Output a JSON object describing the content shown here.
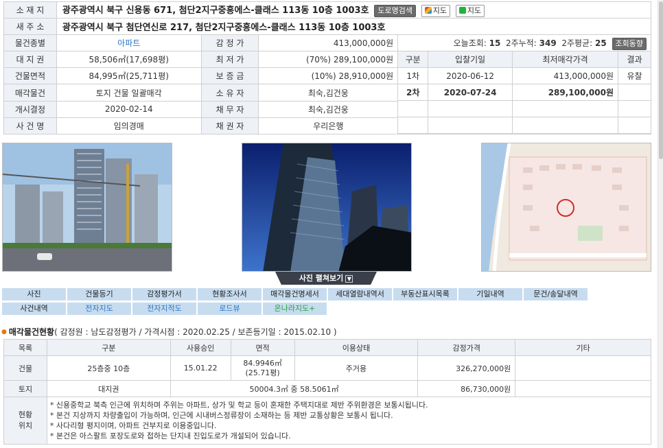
{
  "property": {
    "location_label": "소 재 지",
    "location": "광주광역시 북구 신용동 671, 첨단2지구중흥에스-클래스 113동 10층 1003호",
    "road_search_label": "도로명검색",
    "map_label_1": "지도",
    "map_label_2": "지도",
    "new_address_label": "새 주 소",
    "new_address": "광주광역시 북구 첨단연신로 217, 첨단2지구중흥에스-클래스 113동 10층 1003호",
    "rows": [
      {
        "l1": "물건종별",
        "v1": "아파트",
        "l2": "감 정 가",
        "v2": "413,000,000원"
      },
      {
        "l1": "대 지 권",
        "v1": "58,506㎡(17,698평)",
        "l2": "최 저 가",
        "v2": "(70%) 289,100,000원"
      },
      {
        "l1": "건물면적",
        "v1": "84,995㎡(25,711평)",
        "l2": "보 증 금",
        "v2": "(10%) 28,910,000원"
      },
      {
        "l1": "매각물건",
        "v1": "토지 건물 일괄매각",
        "l2": "소 유 자",
        "v2": "최숙,김건웅"
      },
      {
        "l1": "개시결정",
        "v1": "2020-02-14",
        "l2": "채 무 자",
        "v2": "최숙,김건웅"
      },
      {
        "l1": "사 건 명",
        "v1": "임의경매",
        "l2": "채 권 자",
        "v2": "우리은행"
      }
    ]
  },
  "views": {
    "today_label": "오늘조회:",
    "today": "15",
    "two_week_label": "2주누적:",
    "two_week": "349",
    "avg_label": "2주평균:",
    "avg": "25",
    "trend_button": "조회동향"
  },
  "bids": {
    "headers": [
      "구분",
      "입찰기일",
      "최저매각가격",
      "결과"
    ],
    "rows": [
      {
        "round": "1차",
        "date": "2020-06-12",
        "price": "413,000,000원",
        "result": "유찰"
      },
      {
        "round": "2차",
        "date": "2020-07-24",
        "price": "289,100,000원",
        "result": ""
      }
    ]
  },
  "photo_view_all": "사진 펼쳐보기",
  "nav": {
    "row1": [
      "사진",
      "건물등기",
      "감정평가서",
      "현황조사서",
      "매각물건명세서",
      "세대열람내역서",
      "부동산표시목록",
      "기일내역",
      "문건/송달내역"
    ],
    "row2": [
      "사건내역",
      "전자지도",
      "전자지적도",
      "로드뷰",
      "온나라지도+"
    ]
  },
  "goods": {
    "title": "매각물건현황",
    "subtitle": "( 감정원 : 남도감정평가 / 가격시점 : 2020.02.25 / 보존등기일 : 2015.02.10 )",
    "headers": [
      "목록",
      "구분",
      "사용승인",
      "면적",
      "이용상태",
      "감정가격",
      "기타"
    ],
    "building": {
      "label": "건물",
      "kind": "25층중 10층",
      "approval": "15.01.22",
      "area": "84.9946㎡",
      "area2": "(25.71평)",
      "use": "주거용",
      "price": "326,270,000원"
    },
    "land": {
      "label": "토지",
      "kind": "대지권",
      "area": "50004.3㎡ 중 58.5061㎡",
      "price": "86,730,000원"
    },
    "location_label1": "현황",
    "location_label2": "위치",
    "notes": [
      "* 신용중학교 북측 인근에 위치하며 주위는 아파트, 상가 및 학교 등이 혼재한 주택지대로 제반 주위환경은 보통시됩니다.",
      "* 본건 지상까지 차량출입이 가능하며, 인근에 시내버스정류장이 소재하는 등 제반 교통상황은 보통시 됩니다.",
      "* 사다리형 평지이며, 아파트 건부지로 이용중입니다.",
      "* 본건은 아스팔트 포장도로와 접하는 단지내 진입도로가 개설되어 있습니다."
    ]
  }
}
